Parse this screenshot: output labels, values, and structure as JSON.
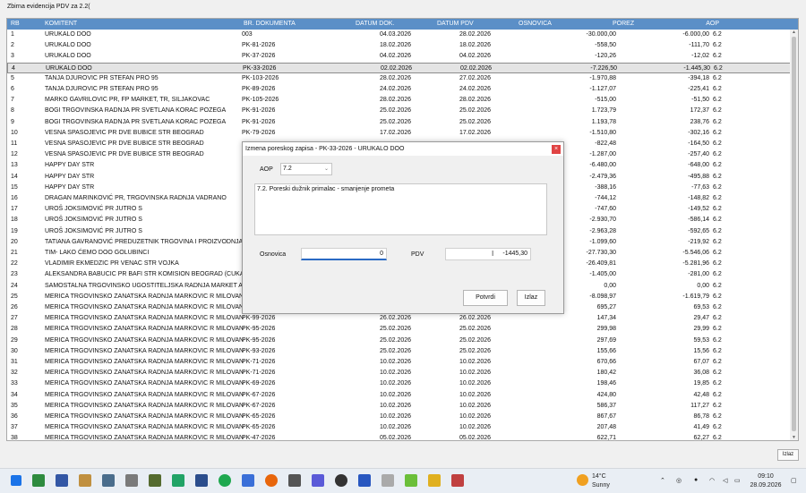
{
  "window": {
    "title": "Zbirna evidencija PDV za 2.2("
  },
  "grid": {
    "headers": [
      "RB",
      "KOMITENT",
      "BR. DOKUMENTA",
      "DATUM DOK.",
      "DATUM PDV",
      "OSNOVICA",
      "POREZ",
      "AOP"
    ],
    "rows": [
      [
        "1",
        "URUKALO DOO",
        "003",
        "04.03.2026",
        "28.02.2026",
        "-30.000,00",
        "-6.000,00",
        "6.2"
      ],
      [
        "2",
        "URUKALO DOO",
        "PK-81-2026",
        "18.02.2026",
        "18.02.2026",
        "-558,50",
        "-111,70",
        "6.2"
      ],
      [
        "3",
        "URUKALO DOO",
        "PK-37-2026",
        "04.02.2026",
        "04.02.2026",
        "-120,26",
        "-12,02",
        "6.2"
      ],
      [
        "4",
        "URUKALO DOO",
        "PK-33-2026",
        "02.02.2026",
        "02.02.2026",
        "-7.226,50",
        "-1.445,30",
        "6.2"
      ],
      [
        "5",
        "TANJA DJUROVIC PR STEFAN PRO 95",
        "PK-103-2026",
        "28.02.2026",
        "27.02.2026",
        "-1.970,88",
        "-394,18",
        "6.2"
      ],
      [
        "6",
        "TANJA DJUROVIC PR STEFAN PRO 95",
        "PK-89-2026",
        "24.02.2026",
        "24.02.2026",
        "-1.127,07",
        "-225,41",
        "6.2"
      ],
      [
        "7",
        "MARKO GAVRILOVIC PR, FP MARKET, TR, SILJAKOVAC",
        "PK-105-2026",
        "28.02.2026",
        "28.02.2026",
        "-515,00",
        "-51,50",
        "6.2"
      ],
      [
        "8",
        "BOGI TRGOVINSKA RADNJA PR SVETLANA KORAC POZEGA",
        "PK-91-2026",
        "25.02.2026",
        "25.02.2026",
        "1.723,79",
        "172,37",
        "6.2"
      ],
      [
        "9",
        "BOGI TRGOVINSKA RADNJA PR SVETLANA KORAC POZEGA",
        "PK-91-2026",
        "25.02.2026",
        "25.02.2026",
        "1.193,78",
        "238,76",
        "6.2"
      ],
      [
        "10",
        "VESNA SPASOJEVIC PR DVE BUBICE STR BEOGRAD",
        "PK-79-2026",
        "17.02.2026",
        "17.02.2026",
        "-1.510,80",
        "-302,16",
        "6.2"
      ],
      [
        "11",
        "VESNA SPASOJEVIC PR DVE BUBICE STR BEOGRAD",
        "",
        "",
        "",
        "-822,48",
        "-164,50",
        "6.2"
      ],
      [
        "12",
        "VESNA SPASOJEVIC PR DVE BUBICE STR BEOGRAD",
        "",
        "",
        "",
        "-1.287,00",
        "-257,40",
        "6.2"
      ],
      [
        "13",
        "HAPPY DAY STR",
        "",
        "",
        "",
        "-6.480,00",
        "-648,00",
        "6.2"
      ],
      [
        "14",
        "HAPPY DAY STR",
        "",
        "",
        "",
        "-2.479,36",
        "-495,88",
        "6.2"
      ],
      [
        "15",
        "HAPPY DAY STR",
        "",
        "",
        "",
        "-388,16",
        "-77,63",
        "6.2"
      ],
      [
        "16",
        "DRAGAN MARINKOVIĆ PR, TRGOVINSKA RADNJA VADRANO",
        "",
        "",
        "",
        "-744,12",
        "-148,82",
        "6.2"
      ],
      [
        "17",
        "UROŠ JOKSIMOVIĆ PR JUTRO S",
        "",
        "",
        "",
        "-747,60",
        "-149,52",
        "6.2"
      ],
      [
        "18",
        "UROŠ JOKSIMOVIĆ PR JUTRO S",
        "",
        "",
        "",
        "-2.930,70",
        "-586,14",
        "6.2"
      ],
      [
        "19",
        "UROŠ JOKSIMOVIĆ PR JUTRO S",
        "",
        "",
        "",
        "-2.963,28",
        "-592,65",
        "6.2"
      ],
      [
        "20",
        "TATIANA GAVRANOVIĆ PREDUZETNIK TRGOVINA I PROIZVODNJA K...",
        "",
        "",
        "",
        "-1.099,60",
        "-219,92",
        "6.2"
      ],
      [
        "21",
        "TIM- LAKO ĆEMO DOO GOLUBINCI",
        "",
        "",
        "",
        "-27.730,30",
        "-5.546,06",
        "6.2"
      ],
      [
        "22",
        "VLADIMIR EKMEDZIC PR VENAC STR VOJKA",
        "",
        "",
        "",
        "-26.409,81",
        "-5.281,96",
        "6.2"
      ],
      [
        "23",
        "ALEKSANDRA BABUCIC PR BAFI STR  KOMISION BEOGRAD (CUKARI...",
        "",
        "",
        "",
        "-1.405,00",
        "-281,00",
        "6.2"
      ],
      [
        "24",
        "SAMOSTALNA TRGOVINSKO UGOSTITELJSKA RADNJA MARKET AS ...",
        "",
        "",
        "",
        "0,00",
        "0,00",
        "6.2"
      ],
      [
        "25",
        "MERICA TRGOVINSKO ZANATSKA  RADNJA MARKOVIC R MILOVAN ...",
        "",
        "",
        "",
        "-8.098,97",
        "-1.619,79",
        "6.2"
      ],
      [
        "26",
        "MERICA TRGOVINSKO ZANATSKA  RADNJA MARKOVIC R MILOVAN ...",
        "",
        "",
        "",
        "695,27",
        "69,53",
        "6.2"
      ],
      [
        "27",
        "MERICA TRGOVINSKO ZANATSKA  RADNJA MARKOVIC R MILOVAN ...",
        "PK-99-2026",
        "26.02.2026",
        "26.02.2026",
        "147,34",
        "29,47",
        "6.2"
      ],
      [
        "28",
        "MERICA TRGOVINSKO ZANATSKA  RADNJA MARKOVIC R MILOVAN ...",
        "PK-95-2026",
        "25.02.2026",
        "25.02.2026",
        "299,98",
        "29,99",
        "6.2"
      ],
      [
        "29",
        "MERICA TRGOVINSKO ZANATSKA  RADNJA MARKOVIC R MILOVAN ...",
        "PK-95-2026",
        "25.02.2026",
        "25.02.2026",
        "297,69",
        "59,53",
        "6.2"
      ],
      [
        "30",
        "MERICA TRGOVINSKO ZANATSKA  RADNJA MARKOVIC R MILOVAN ...",
        "PK-93-2026",
        "25.02.2026",
        "25.02.2026",
        "155,66",
        "15,56",
        "6.2"
      ],
      [
        "31",
        "MERICA TRGOVINSKO ZANATSKA  RADNJA MARKOVIC R MILOVAN ...",
        "PK-71-2026",
        "10.02.2026",
        "10.02.2026",
        "670,66",
        "67,07",
        "6.2"
      ],
      [
        "32",
        "MERICA TRGOVINSKO ZANATSKA  RADNJA MARKOVIC R MILOVAN ...",
        "PK-71-2026",
        "10.02.2026",
        "10.02.2026",
        "180,42",
        "36,08",
        "6.2"
      ],
      [
        "33",
        "MERICA TRGOVINSKO ZANATSKA  RADNJA MARKOVIC R MILOVAN ...",
        "PK-69-2026",
        "10.02.2026",
        "10.02.2026",
        "198,46",
        "19,85",
        "6.2"
      ],
      [
        "34",
        "MERICA TRGOVINSKO ZANATSKA  RADNJA MARKOVIC R MILOVAN ...",
        "PK-67-2026",
        "10.02.2026",
        "10.02.2026",
        "424,80",
        "42,48",
        "6.2"
      ],
      [
        "35",
        "MERICA TRGOVINSKO ZANATSKA  RADNJA MARKOVIC R MILOVAN ...",
        "PK-67-2026",
        "10.02.2026",
        "10.02.2026",
        "586,37",
        "117,27",
        "6.2"
      ],
      [
        "36",
        "MERICA TRGOVINSKO ZANATSKA  RADNJA MARKOVIC R MILOVAN ...",
        "PK-65-2026",
        "10.02.2026",
        "10.02.2026",
        "867,67",
        "86,78",
        "6.2"
      ],
      [
        "37",
        "MERICA TRGOVINSKO ZANATSKA  RADNJA MARKOVIC R MILOVAN ...",
        "PK-65-2026",
        "10.02.2026",
        "10.02.2026",
        "207,48",
        "41,49",
        "6.2"
      ],
      [
        "38",
        "MERICA TRGOVINSKO ZANATSKA  RADNJA MARKOVIC R MILOVAN ...",
        "PK-47-2026",
        "05.02.2026",
        "05.02.2026",
        "622,71",
        "62,27",
        "6.2"
      ]
    ],
    "selected_index": 3
  },
  "dialog": {
    "title": "Izmena poreskog zapisa - PK-33-2026 - URUKALO DOO",
    "close_label": "×",
    "aop_label": "AOP",
    "aop_value": "7.2",
    "description": "7.2. Poreski dužnik primalac - smanjenje prometa",
    "osnovica_label": "Osnovica",
    "osnovica_value": "0",
    "pdv_label": "PDV",
    "pdv_value": "-1445,30",
    "confirm_label": "Potvrdi",
    "exit_label": "Izlaz"
  },
  "footer": {
    "exit_label": "Izlaz"
  },
  "taskbar": {
    "weather_temp": "14°C",
    "weather_desc": "Sunny",
    "time": "09:10",
    "date": "28.09.2026",
    "accent": "#0067c0"
  }
}
